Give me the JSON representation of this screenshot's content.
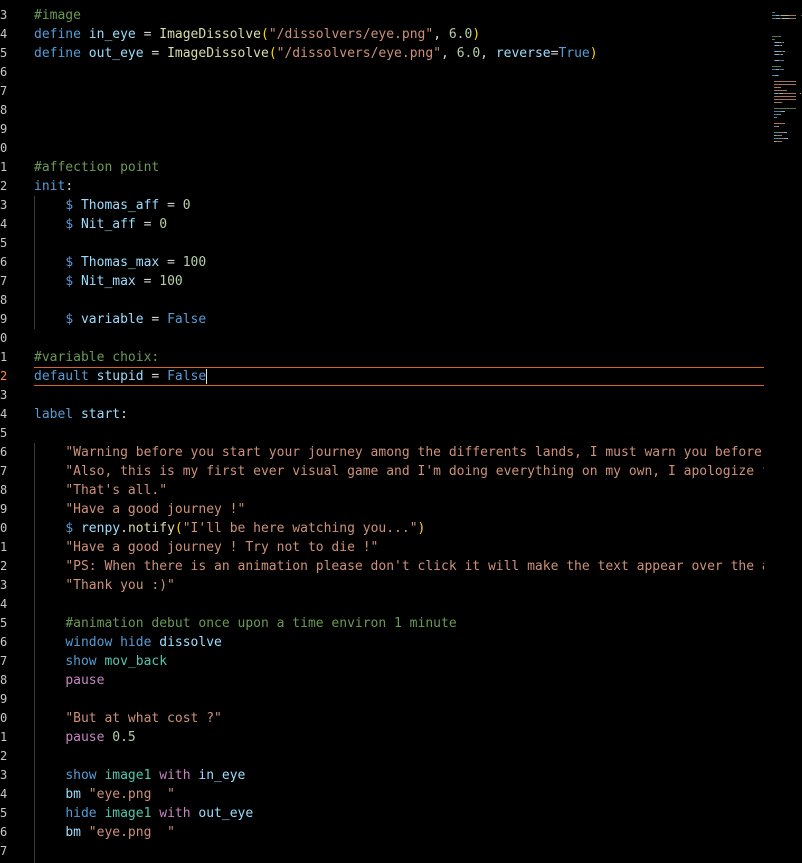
{
  "editor": {
    "lines": [
      {
        "num": "3",
        "tokens": [
          {
            "t": "#image",
            "c": "cmt"
          }
        ]
      },
      {
        "num": "4",
        "tokens": [
          {
            "t": "define ",
            "c": "kw"
          },
          {
            "t": "in_eye",
            "c": "var"
          },
          {
            "t": " = ",
            "c": "op"
          },
          {
            "t": "ImageDissolve",
            "c": "fn"
          },
          {
            "t": "(",
            "c": "br"
          },
          {
            "t": "\"/dissolvers/eye.png\"",
            "c": "str"
          },
          {
            "t": ", ",
            "c": "op"
          },
          {
            "t": "6.0",
            "c": "num"
          },
          {
            "t": ")",
            "c": "br"
          }
        ]
      },
      {
        "num": "5",
        "tokens": [
          {
            "t": "define ",
            "c": "kw"
          },
          {
            "t": "out_eye",
            "c": "var"
          },
          {
            "t": " = ",
            "c": "op"
          },
          {
            "t": "ImageDissolve",
            "c": "fn"
          },
          {
            "t": "(",
            "c": "br"
          },
          {
            "t": "\"/dissolvers/eye.png\"",
            "c": "str"
          },
          {
            "t": ", ",
            "c": "op"
          },
          {
            "t": "6.0",
            "c": "num"
          },
          {
            "t": ", ",
            "c": "op"
          },
          {
            "t": "reverse",
            "c": "param"
          },
          {
            "t": "=",
            "c": "op"
          },
          {
            "t": "True",
            "c": "const"
          },
          {
            "t": ")",
            "c": "br"
          }
        ]
      },
      {
        "num": "6",
        "tokens": []
      },
      {
        "num": "7",
        "tokens": []
      },
      {
        "num": "8",
        "tokens": []
      },
      {
        "num": "9",
        "tokens": []
      },
      {
        "num": "0",
        "tokens": []
      },
      {
        "num": "1",
        "tokens": [
          {
            "t": "#affection point",
            "c": "cmt"
          }
        ]
      },
      {
        "num": "2",
        "tokens": [
          {
            "t": "init",
            "c": "kw"
          },
          {
            "t": ":",
            "c": "op"
          }
        ]
      },
      {
        "num": "3",
        "tokens": [
          {
            "t": "    ",
            "c": "op"
          },
          {
            "t": "$ ",
            "c": "kw"
          },
          {
            "t": "Thomas_aff",
            "c": "var"
          },
          {
            "t": " = ",
            "c": "op"
          },
          {
            "t": "0",
            "c": "num"
          }
        ]
      },
      {
        "num": "4",
        "tokens": [
          {
            "t": "    ",
            "c": "op"
          },
          {
            "t": "$ ",
            "c": "kw"
          },
          {
            "t": "Nit_aff",
            "c": "var"
          },
          {
            "t": " = ",
            "c": "op"
          },
          {
            "t": "0",
            "c": "num"
          }
        ]
      },
      {
        "num": "5",
        "tokens": []
      },
      {
        "num": "6",
        "tokens": [
          {
            "t": "    ",
            "c": "op"
          },
          {
            "t": "$ ",
            "c": "kw"
          },
          {
            "t": "Thomas_max",
            "c": "var"
          },
          {
            "t": " = ",
            "c": "op"
          },
          {
            "t": "100",
            "c": "num"
          }
        ]
      },
      {
        "num": "7",
        "tokens": [
          {
            "t": "    ",
            "c": "op"
          },
          {
            "t": "$ ",
            "c": "kw"
          },
          {
            "t": "Nit_max",
            "c": "var"
          },
          {
            "t": " = ",
            "c": "op"
          },
          {
            "t": "100",
            "c": "num"
          }
        ]
      },
      {
        "num": "8",
        "tokens": []
      },
      {
        "num": "9",
        "tokens": [
          {
            "t": "    ",
            "c": "op"
          },
          {
            "t": "$ ",
            "c": "kw"
          },
          {
            "t": "variable",
            "c": "var"
          },
          {
            "t": " = ",
            "c": "op"
          },
          {
            "t": "False",
            "c": "const"
          }
        ]
      },
      {
        "num": "0",
        "tokens": []
      },
      {
        "num": "1",
        "tokens": [
          {
            "t": "#variable choix:",
            "c": "cmt"
          }
        ]
      },
      {
        "num": "2",
        "current": true,
        "tokens": [
          {
            "t": "default ",
            "c": "kw"
          },
          {
            "t": "stupid",
            "c": "var"
          },
          {
            "t": " = ",
            "c": "op"
          },
          {
            "t": "False",
            "c": "const"
          }
        ]
      },
      {
        "num": "3",
        "tokens": []
      },
      {
        "num": "4",
        "tokens": [
          {
            "t": "label ",
            "c": "kw"
          },
          {
            "t": "start",
            "c": "var"
          },
          {
            "t": ":",
            "c": "op"
          }
        ]
      },
      {
        "num": "5",
        "tokens": []
      },
      {
        "num": "6",
        "tokens": [
          {
            "t": "    ",
            "c": "op"
          },
          {
            "t": "\"Warning before you start your journey among the differents lands, I must warn you before, ",
            "c": "str"
          }
        ]
      },
      {
        "num": "7",
        "tokens": [
          {
            "t": "    ",
            "c": "op"
          },
          {
            "t": "\"Also, this is my first ever visual game and I'm doing everything on my own, I apologize fo",
            "c": "str"
          }
        ]
      },
      {
        "num": "8",
        "tokens": [
          {
            "t": "    ",
            "c": "op"
          },
          {
            "t": "\"That's all.\"",
            "c": "str"
          }
        ]
      },
      {
        "num": "9",
        "tokens": [
          {
            "t": "    ",
            "c": "op"
          },
          {
            "t": "\"Have a good journey !\"",
            "c": "str"
          }
        ]
      },
      {
        "num": "0",
        "tokens": [
          {
            "t": "    ",
            "c": "op"
          },
          {
            "t": "$ ",
            "c": "kw"
          },
          {
            "t": "renpy",
            "c": "var"
          },
          {
            "t": ".",
            "c": "op"
          },
          {
            "t": "notify",
            "c": "fn"
          },
          {
            "t": "(",
            "c": "br"
          },
          {
            "t": "\"I'll be here watching you...\"",
            "c": "str"
          },
          {
            "t": ")",
            "c": "br"
          }
        ]
      },
      {
        "num": "1",
        "tokens": [
          {
            "t": "    ",
            "c": "op"
          },
          {
            "t": "\"Have a good journey ! Try not to die !\"",
            "c": "str"
          }
        ]
      },
      {
        "num": "2",
        "tokens": [
          {
            "t": "    ",
            "c": "op"
          },
          {
            "t": "\"PS: When there is an animation please don't click it will make the text appear over the an",
            "c": "str"
          }
        ]
      },
      {
        "num": "3",
        "tokens": [
          {
            "t": "    ",
            "c": "op"
          },
          {
            "t": "\"Thank you :)\"",
            "c": "str"
          }
        ]
      },
      {
        "num": "4",
        "tokens": []
      },
      {
        "num": "5",
        "tokens": [
          {
            "t": "    ",
            "c": "op"
          },
          {
            "t": "#animation debut once upon a time environ 1 minute",
            "c": "cmt"
          }
        ]
      },
      {
        "num": "6",
        "tokens": [
          {
            "t": "    ",
            "c": "op"
          },
          {
            "t": "window ",
            "c": "kw"
          },
          {
            "t": "hide ",
            "c": "kw"
          },
          {
            "t": "dissolve",
            "c": "var"
          }
        ]
      },
      {
        "num": "7",
        "tokens": [
          {
            "t": "    ",
            "c": "op"
          },
          {
            "t": "show ",
            "c": "kw"
          },
          {
            "t": "mov_back",
            "c": "img"
          }
        ]
      },
      {
        "num": "8",
        "tokens": [
          {
            "t": "    ",
            "c": "op"
          },
          {
            "t": "pause",
            "c": "ctl"
          }
        ]
      },
      {
        "num": "9",
        "tokens": []
      },
      {
        "num": "0",
        "tokens": [
          {
            "t": "    ",
            "c": "op"
          },
          {
            "t": "\"But at what cost ?\"",
            "c": "str"
          }
        ]
      },
      {
        "num": "1",
        "tokens": [
          {
            "t": "    ",
            "c": "op"
          },
          {
            "t": "pause ",
            "c": "ctl"
          },
          {
            "t": "0.5",
            "c": "num"
          }
        ]
      },
      {
        "num": "2",
        "tokens": []
      },
      {
        "num": "3",
        "tokens": [
          {
            "t": "    ",
            "c": "op"
          },
          {
            "t": "show ",
            "c": "kw"
          },
          {
            "t": "image1 ",
            "c": "img"
          },
          {
            "t": "with ",
            "c": "ctl"
          },
          {
            "t": "in_eye",
            "c": "var"
          }
        ]
      },
      {
        "num": "4",
        "tokens": [
          {
            "t": "    ",
            "c": "op"
          },
          {
            "t": "bm ",
            "c": "var"
          },
          {
            "t": "\"eye.png  \"",
            "c": "str"
          }
        ]
      },
      {
        "num": "5",
        "tokens": [
          {
            "t": "    ",
            "c": "op"
          },
          {
            "t": "hide ",
            "c": "kw"
          },
          {
            "t": "image1 ",
            "c": "img"
          },
          {
            "t": "with ",
            "c": "ctl"
          },
          {
            "t": "out_eye",
            "c": "var"
          }
        ]
      },
      {
        "num": "6",
        "tokens": [
          {
            "t": "    ",
            "c": "op"
          },
          {
            "t": "bm ",
            "c": "var"
          },
          {
            "t": "\"eye.png  \"",
            "c": "str"
          }
        ]
      },
      {
        "num": "7",
        "tokens": []
      }
    ]
  },
  "minimap": {
    "visible": true
  },
  "colors": {
    "background": "#000000",
    "current_line_border": "#d7651a",
    "current_line_number": "#ff8c40"
  }
}
